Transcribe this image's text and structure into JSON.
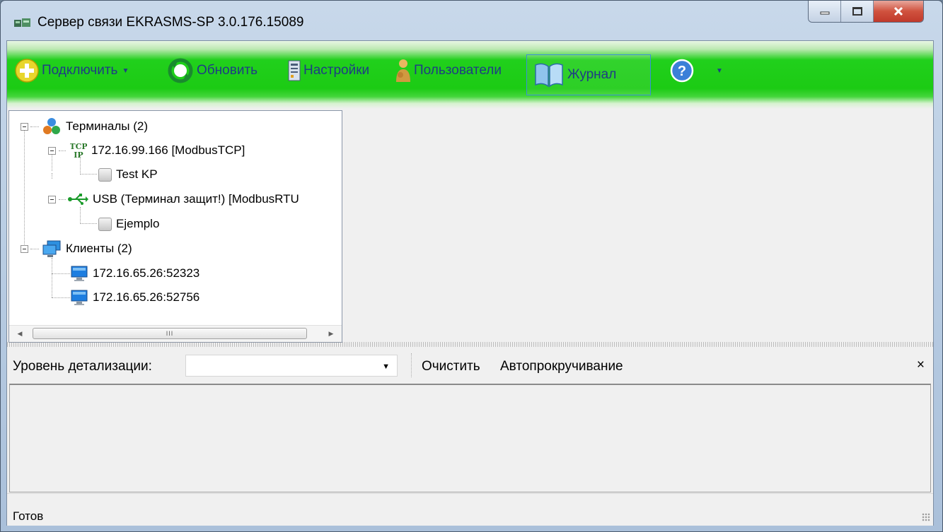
{
  "window": {
    "title": "Сервер связи EKRASMS-SP 3.0.176.15089"
  },
  "toolbar": {
    "connect_label": "Подключить",
    "refresh_label": "Обновить",
    "settings_label": "Настройки",
    "users_label": "Пользователи",
    "journal_label": "Журнал"
  },
  "tree": {
    "terminals": "Терминалы (2)",
    "terminal_1": "172.16.99.166 [ModbusTCP]",
    "device_1": "Test KP",
    "terminal_2": "USB (Терминал защит!) [ModbusRTU",
    "device_2": "Ejemplo",
    "clients": "Клиенты (2)",
    "client_1": "172.16.65.26:52323",
    "client_2": "172.16.65.26:52756",
    "scroll_thumb": "III"
  },
  "log": {
    "level_label": "Уровень детализации:",
    "level_value": "",
    "clear_label": "Очистить",
    "autoscroll_label": "Автопрокручивание",
    "close_symbol": "×"
  },
  "status": {
    "text": "Готов"
  },
  "colors": {
    "toolbar_green": "#1ccb14",
    "toolbar_text": "#1f3c85",
    "close_red": "#c0392b"
  }
}
